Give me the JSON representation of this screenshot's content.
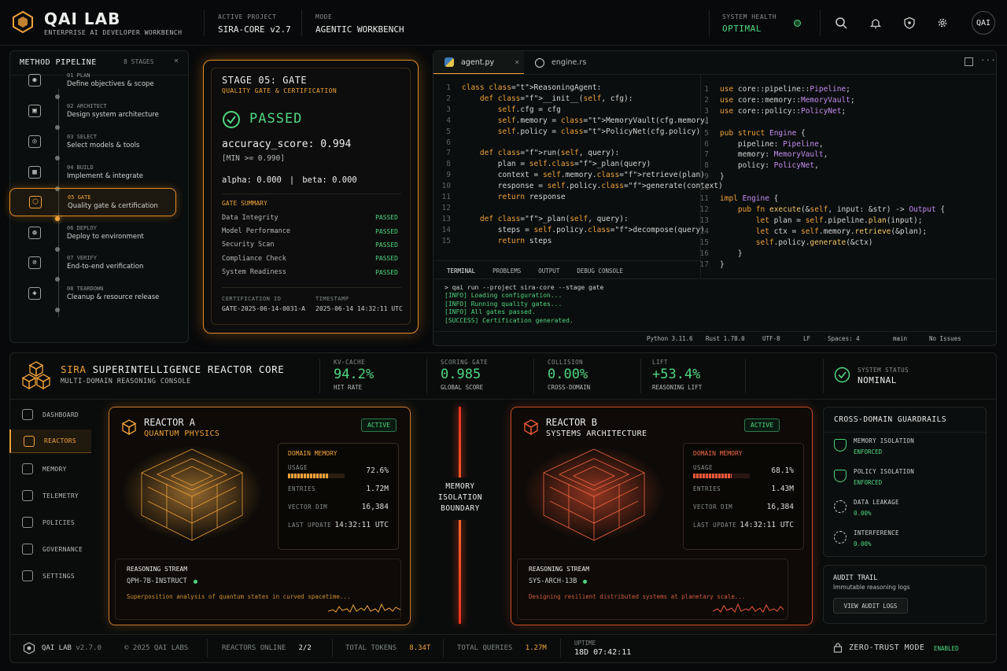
{
  "header": {
    "brand": "QAI LAB",
    "subtitle": "ENTERPRISE AI DEVELOPER WORKBENCH",
    "project_label": "ACTIVE PROJECT",
    "project": "SIRA-CORE v2.7",
    "mode_label": "MODE",
    "mode": "AGENTIC WORKBENCH",
    "health_label": "SYSTEM HEALTH",
    "health": "OPTIMAL",
    "avatar": "QAI"
  },
  "pipeline": {
    "title": "METHOD PIPELINE",
    "count": "8 STAGES",
    "stages": [
      {
        "num": "01 PLAN",
        "desc": "Define objectives & scope"
      },
      {
        "num": "02 ARCHITECT",
        "desc": "Design system architecture"
      },
      {
        "num": "03 SELECT",
        "desc": "Select models & tools"
      },
      {
        "num": "04 BUILD",
        "desc": "Implement & integrate"
      },
      {
        "num": "05 GATE",
        "desc": "Quality gate & certification"
      },
      {
        "num": "06 DEPLOY",
        "desc": "Deploy to environment"
      },
      {
        "num": "07 VERIFY",
        "desc": "End-to-end verification"
      },
      {
        "num": "08 TEARDOWN",
        "desc": "Cleanup & resource release"
      }
    ]
  },
  "gate": {
    "title": "STAGE 05: GATE",
    "subtitle": "QUALITY GATE & CERTIFICATION",
    "status": "PASSED",
    "score": "accuracy_score: 0.994",
    "min": "[MIN >= 0.990]",
    "alpha": "alpha: 0.000",
    "sep": "|",
    "beta": "beta: 0.000",
    "summary_title": "GATE SUMMARY",
    "summary": [
      {
        "k": "Data Integrity",
        "v": "PASSED"
      },
      {
        "k": "Model Performance",
        "v": "PASSED"
      },
      {
        "k": "Security Scan",
        "v": "PASSED"
      },
      {
        "k": "Compliance Check",
        "v": "PASSED"
      },
      {
        "k": "System Readiness",
        "v": "PASSED"
      }
    ],
    "cert_label": "CERTIFICATION ID",
    "cert": "GATE-2025-06-14-0031-A",
    "ts_label": "TIMESTAMP",
    "ts": "2025-06-14 14:32:11 UTC"
  },
  "editor": {
    "tabs": [
      "agent.py",
      "engine.rs"
    ],
    "py": [
      "class ReasoningAgent:",
      "    def __init__(self, cfg):",
      "        self.cfg = cfg",
      "        self.memory = MemoryVault(cfg.memory)",
      "        self.policy = PolicyNet(cfg.policy)",
      "",
      "    def run(self, query):",
      "        plan = self._plan(query)",
      "        context = self.memory.retrieve(plan)",
      "        response = self.policy.generate(context)",
      "        return response",
      "",
      "    def _plan(self, query):",
      "        steps = self.policy.decompose(query)",
      "        return steps"
    ],
    "rs": [
      "use core::pipeline::Pipeline;",
      "use core::memory::MemoryVault;",
      "use core::policy::PolicyNet;",
      "",
      "pub struct Engine {",
      "    pipeline: Pipeline,",
      "    memory: MemoryVault,",
      "    policy: PolicyNet,",
      "}",
      "",
      "impl Engine {",
      "    pub fn execute(&self, input: &str) -> Output {",
      "        let plan = self.pipeline.plan(input);",
      "        let ctx = self.memory.retrieve(&plan);",
      "        self.policy.generate(&ctx)",
      "    }",
      "}"
    ],
    "term_tabs": [
      "TERMINAL",
      "PROBLEMS",
      "OUTPUT",
      "DEBUG CONSOLE"
    ],
    "term": [
      "> qai run --project sira-core --stage gate",
      "[INFO] Loading configuration...",
      "[INFO] Running quality gates...",
      "[INFO] All gates passed.",
      "[SUCCESS] Certification generated."
    ],
    "status": [
      "Python 3.11.6",
      "Rust 1.78.0",
      "UTF-8",
      "LF",
      "Spaces: 4",
      "main",
      "No Issues"
    ]
  },
  "core": {
    "title_a": "SIRA",
    "title_b": "SUPERINTELLIGENCE REACTOR CORE",
    "subtitle": "MULTI-DOMAIN REASONING CONSOLE",
    "metrics": [
      {
        "label": "KV-CACHE",
        "value": "94.2%",
        "sub": "HIT RATE"
      },
      {
        "label": "SCORING GATE",
        "value": "0.985",
        "sub": "GLOBAL SCORE"
      },
      {
        "label": "COLLISION",
        "value": "0.00%",
        "sub": "CROSS-DOMAIN"
      },
      {
        "label": "LIFT",
        "value": "+53.4%",
        "sub": "REASONING LIFT"
      }
    ],
    "sys_label": "SYSTEM STATUS",
    "sys": "NOMINAL"
  },
  "nav": [
    "DASHBOARD",
    "REACTORS",
    "MEMORY",
    "TELEMETRY",
    "POLICIES",
    "GOVERNANCE",
    "SETTINGS"
  ],
  "reactor_a": {
    "name": "REACTOR A",
    "domain": "QUANTUM PHYSICS",
    "badge": "ACTIVE",
    "mem_title": "DOMAIN MEMORY",
    "usage_label": "USAGE",
    "usage": "72.6%",
    "usage_frac": 0.726,
    "entries_label": "ENTRIES",
    "entries": "1.72M",
    "vdim_label": "VECTOR DIM",
    "vdim": "16,384",
    "upd_label": "LAST UPDATE",
    "upd": "14:32:11 UTC",
    "stream_title": "REASONING STREAM",
    "model": "QPH-7B-INSTRUCT",
    "stream": "Superposition analysis of quantum states in curved spacetime..."
  },
  "reactor_b": {
    "name": "REACTOR B",
    "domain": "SYSTEMS ARCHITECTURE",
    "badge": "ACTIVE",
    "mem_title": "DOMAIN MEMORY",
    "usage_label": "USAGE",
    "usage": "68.1%",
    "usage_frac": 0.681,
    "entries_label": "ENTRIES",
    "entries": "1.43M",
    "vdim_label": "VECTOR DIM",
    "vdim": "16,384",
    "upd_label": "LAST UPDATE",
    "upd": "14:32:11 UTC",
    "stream_title": "REASONING STREAM",
    "model": "SYS-ARCH-13B",
    "stream": "Designing resilient distributed systems at planetary scale..."
  },
  "boundary": [
    "MEMORY",
    "ISOLATION",
    "BOUNDARY"
  ],
  "guardrails": {
    "title": "CROSS-DOMAIN GUARDRAILS",
    "items": [
      {
        "k": "MEMORY ISOLATION",
        "v": "ENFORCED"
      },
      {
        "k": "POLICY ISOLATION",
        "v": "ENFORCED"
      },
      {
        "k": "DATA LEAKAGE",
        "v": "0.00%"
      },
      {
        "k": "INTERFERENCE",
        "v": "0.00%"
      }
    ]
  },
  "audit": {
    "title": "AUDIT TRAIL",
    "sub": "Immutable reasoning logs",
    "btn": "VIEW AUDIT LOGS"
  },
  "footer": {
    "brand": "QAI LAB",
    "ver": "v2.7.0",
    "copy": "© 2025 QAI LABS",
    "online_l": "REACTORS ONLINE",
    "online": "2/2",
    "tokens_l": "TOTAL TOKENS",
    "tokens": "8.34T",
    "queries_l": "TOTAL QUERIES",
    "queries": "1.27M",
    "uptime_l": "UPTIME",
    "uptime": "18D 07:42:11",
    "zt": "ZERO-TRUST MODE",
    "zt_state": "ENABLED"
  }
}
